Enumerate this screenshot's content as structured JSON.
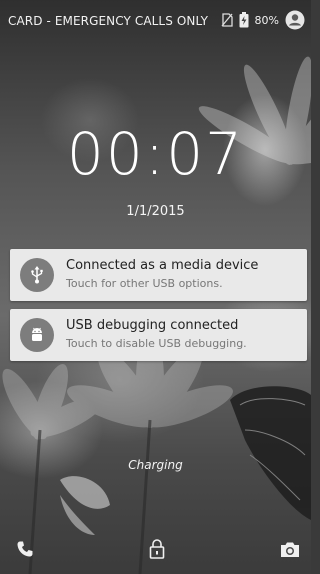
{
  "status_bar": {
    "carrier_text": "CARD - EMERGENCY CALLS ONLY",
    "battery_percent": "80%"
  },
  "lockscreen": {
    "time": "00:07",
    "date": "1/1/2015",
    "charging_label": "Charging"
  },
  "notifications": [
    {
      "title": "Connected as a media device",
      "subtitle": "Touch for other USB options.",
      "icon": "usb-icon"
    },
    {
      "title": "USB debugging connected",
      "subtitle": "Touch to disable USB debugging.",
      "icon": "android-icon"
    }
  ],
  "shortcuts": {
    "left": "phone-icon",
    "center": "lock-icon",
    "right": "camera-icon"
  }
}
